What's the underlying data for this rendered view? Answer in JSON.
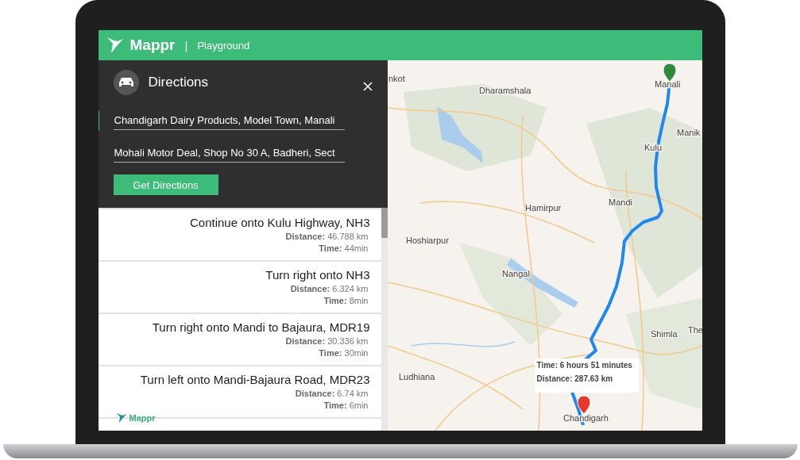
{
  "header": {
    "brand": "Mappr",
    "separator": "|",
    "section": "Playground"
  },
  "directions": {
    "title": "Directions",
    "fields": [
      {
        "value": "Chandigarh Dairy Products, Model Town, Manali",
        "focused": true
      },
      {
        "value": "Mohali Motor Deal, Shop No 30 A, Badheri, Sect",
        "focused": false
      }
    ],
    "button": "Get Directions"
  },
  "steps": [
    {
      "instruction": "Continue onto Kulu Highway, NH3",
      "distance": "**Distance:** 46.788 km",
      "time": "**Time:** 44min"
    },
    {
      "instruction": "Turn right onto NH3",
      "distance": "**Distance:** 6.324 km",
      "time": "**Time:** 8min"
    },
    {
      "instruction": "Turn right onto Mandi to Bajaura, MDR19",
      "distance": "**Distance:** 30.336 km",
      "time": "**Time:** 30min"
    },
    {
      "instruction": "Turn left onto Mandi-Bajaura Road, MDR23",
      "distance": "**Distance:** 6.74 km",
      "time": "**Time:** 6min"
    }
  ],
  "list_logo": "Mappr",
  "map": {
    "labels": [
      "nkot",
      "Dharamshala",
      "Manali",
      "Manik",
      "Kulu",
      "Hamirpur",
      "Mandi",
      "Hoshiarpur",
      "Nangal",
      "Shimla",
      "The",
      "Ludhiana",
      "Chandigarh"
    ],
    "tooltip": {
      "time": "Time: 6 hours 51 minutes",
      "distance": "Distance: 287.63 km"
    }
  }
}
